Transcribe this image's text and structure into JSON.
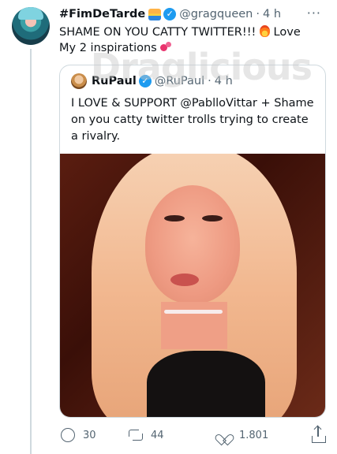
{
  "tweet": {
    "display_name": "#FimDeTarde",
    "handle": "@gragqueen",
    "separator": "·",
    "time": "4 h",
    "more": "···",
    "text_part1": "SHAME ON YOU CATTY TWITTER!!!",
    "text_part2": "Love My 2 inspirations"
  },
  "watermark": "Draglicious",
  "quoted_tweet": {
    "display_name": "RuPaul",
    "handle": "@RuPaul",
    "separator": "·",
    "time": "4 h",
    "text": "I LOVE & SUPPORT @PablloVittar + Shame on you catty twitter trolls trying to create a rivalry."
  },
  "actions": {
    "replies": "30",
    "retweets": "44",
    "likes": "1.801"
  },
  "icons": [
    "sunset-emoji-icon",
    "verified-badge-icon",
    "more-icon",
    "fire-emoji-icon",
    "two-hearts-emoji-icon",
    "reply-icon",
    "retweet-icon",
    "like-icon",
    "share-icon"
  ],
  "colors": {
    "verified": "#1d9bf0",
    "secondary_text": "#536471",
    "primary_text": "#0f1419",
    "border": "#cfd9de"
  }
}
